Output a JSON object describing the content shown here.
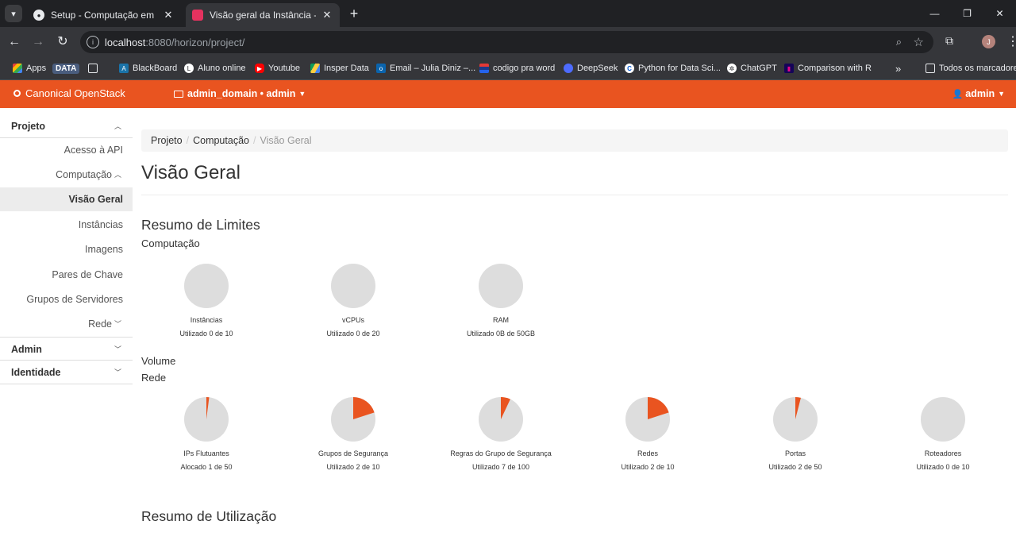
{
  "browser": {
    "tabs": [
      {
        "title": "Setup - Computação em Nuvem",
        "active": false
      },
      {
        "title": "Visão geral da Instância - OpenStack Dashboard",
        "active": true
      }
    ],
    "url_host": "localhost",
    "url_rest": ":8080/horizon/project/",
    "profile_initial": "J",
    "bookmarks": [
      {
        "label": "Apps",
        "icon": "apps-grid-icon"
      },
      {
        "label": "DATA",
        "icon": "data-badge"
      },
      {
        "label": "",
        "icon": "grid-icon"
      },
      {
        "label": "BlackBoard",
        "icon": "blackboard-icon"
      },
      {
        "label": "Aluno online",
        "icon": "aluno-online-icon"
      },
      {
        "label": "Youtube",
        "icon": "youtube-icon"
      },
      {
        "label": "Insper Data",
        "icon": "google-drive-icon"
      },
      {
        "label": "Email – Julia Diniz –...",
        "icon": "outlook-icon"
      },
      {
        "label": "codigo pra word",
        "icon": "stack-icon"
      },
      {
        "label": "DeepSeek",
        "icon": "deepseek-icon"
      },
      {
        "label": "Python for Data Sci...",
        "icon": "coursera-icon"
      },
      {
        "label": "ChatGPT",
        "icon": "chatgpt-icon"
      },
      {
        "label": "Comparison with R",
        "icon": "pandas-icon"
      }
    ],
    "all_bookmarks_label": "Todos os marcadores"
  },
  "header": {
    "brand": "Canonical OpenStack",
    "domain_selector": "admin_domain • admin",
    "user": "admin"
  },
  "sidebar": {
    "groups": {
      "projeto": "Projeto",
      "admin": "Admin",
      "identidade": "Identidade"
    },
    "items": {
      "api": "Acesso à API",
      "computacao": "Computação",
      "visao_geral": "Visão Geral",
      "instancias": "Instâncias",
      "imagens": "Imagens",
      "pares": "Pares de Chave",
      "grupos_servidores": "Grupos de Servidores",
      "rede": "Rede"
    }
  },
  "breadcrumb": [
    "Projeto",
    "Computação",
    "Visão Geral"
  ],
  "page_title": "Visão Geral",
  "limits": {
    "heading": "Resumo de Limites",
    "compute_heading": "Computação",
    "volume_heading": "Volume",
    "network_heading": "Rede",
    "compute": [
      {
        "label": "Instâncias",
        "usage": "Utilizado 0 de 10",
        "used": 0,
        "total": 10
      },
      {
        "label": "vCPUs",
        "usage": "Utilizado 0 de 20",
        "used": 0,
        "total": 20
      },
      {
        "label": "RAM",
        "usage": "Utilizado 0B de 50GB",
        "used": 0,
        "total": 50
      }
    ],
    "network": [
      {
        "label": "IPs Flutuantes",
        "usage": "Alocado 1 de 50",
        "used": 1,
        "total": 50
      },
      {
        "label": "Grupos de Segurança",
        "usage": "Utilizado 2 de 10",
        "used": 2,
        "total": 10
      },
      {
        "label": "Regras do Grupo de Segurança",
        "usage": "Utilizado 7 de 100",
        "used": 7,
        "total": 100
      },
      {
        "label": "Redes",
        "usage": "Utilizado 2 de 10",
        "used": 2,
        "total": 10
      },
      {
        "label": "Portas",
        "usage": "Utilizado 2 de 50",
        "used": 2,
        "total": 50
      },
      {
        "label": "Roteadores",
        "usage": "Utilizado 0 de 10",
        "used": 0,
        "total": 10
      }
    ]
  },
  "usage": {
    "heading": "Resumo de Utilização"
  },
  "colors": {
    "accent": "#e95420",
    "pie_bg": "#dddddd"
  }
}
